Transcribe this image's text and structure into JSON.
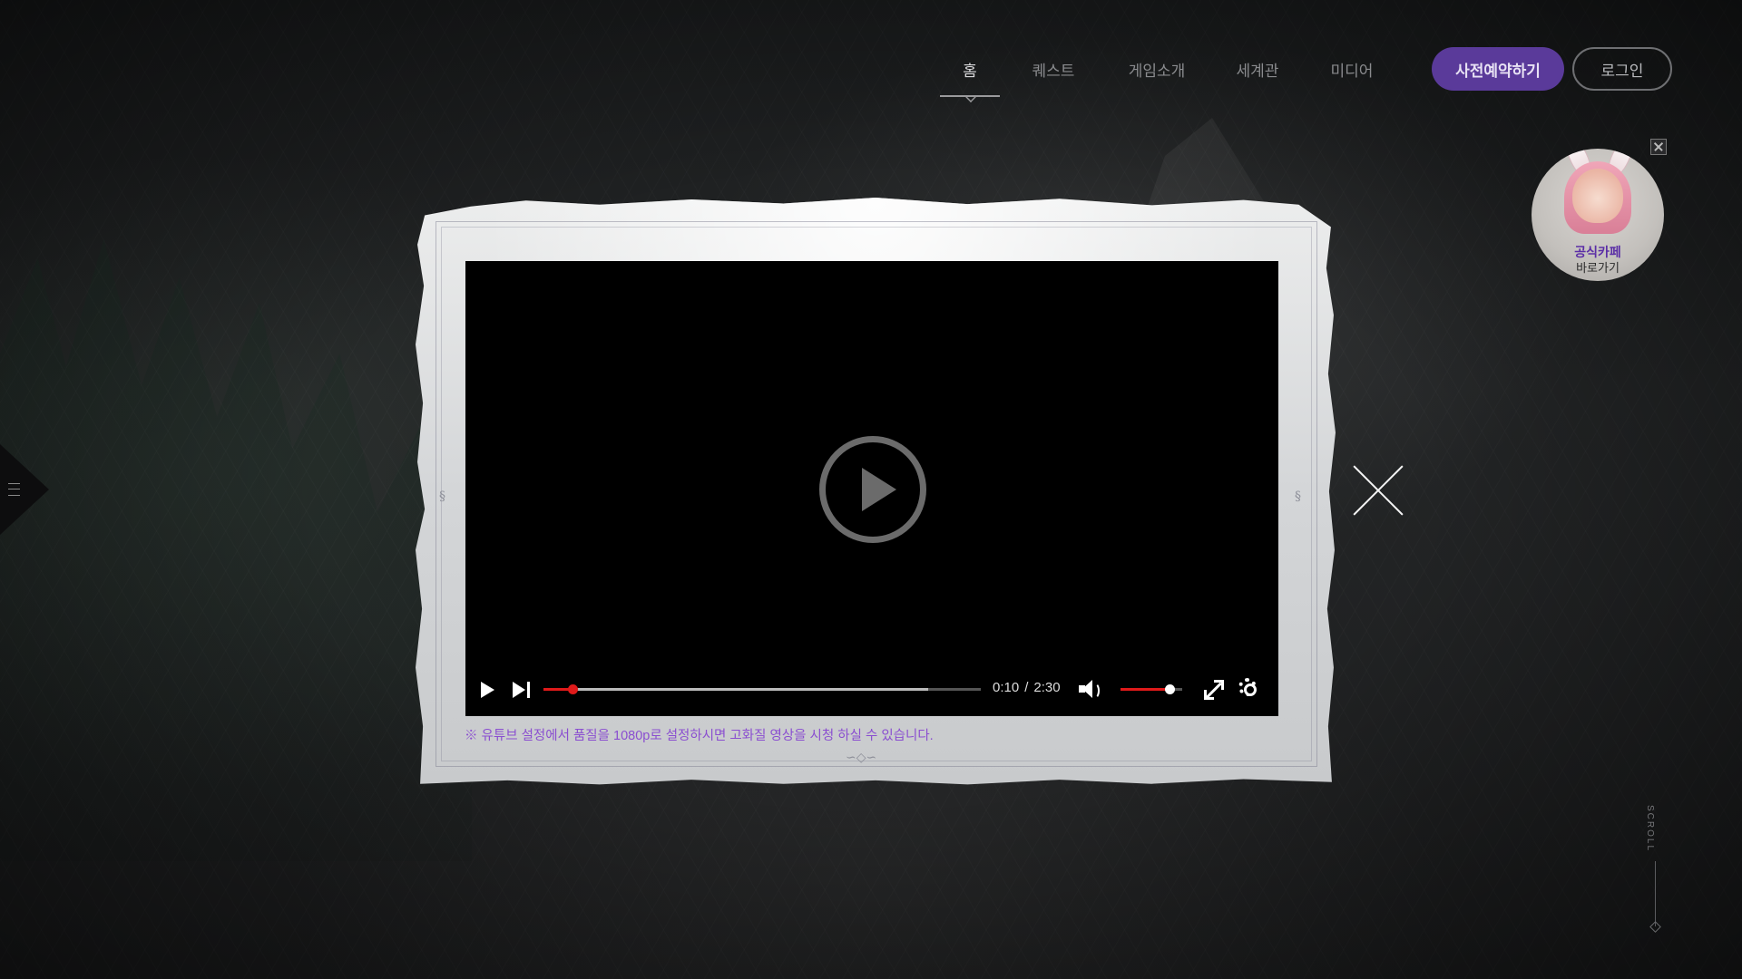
{
  "nav": {
    "items": [
      {
        "label": "홈",
        "active": true
      },
      {
        "label": "퀘스트",
        "active": false
      },
      {
        "label": "게임소개",
        "active": false
      },
      {
        "label": "세계관",
        "active": false
      },
      {
        "label": "미디어",
        "active": false
      }
    ],
    "reserve_label": "사전예약하기",
    "login_label": "로그인"
  },
  "cafe_badge": {
    "title": "공식카페",
    "subtitle": "바로가기"
  },
  "video_player": {
    "current_time": "0:10",
    "separator": "/",
    "duration": "2:30",
    "progress_fraction": 0.067,
    "buffered_fraction": 0.88,
    "volume_fraction": 0.8,
    "accent_color": "#e01a1a"
  },
  "notice": "※ 유튜브 설정에서 품질을 1080p로 설정하시면 고화질 영상을 시청 하실 수 있습니다.",
  "scroll_label": "SCROLL",
  "colors": {
    "reserve_button": "#5a3a9a",
    "notice_text": "#8a4ed0"
  }
}
